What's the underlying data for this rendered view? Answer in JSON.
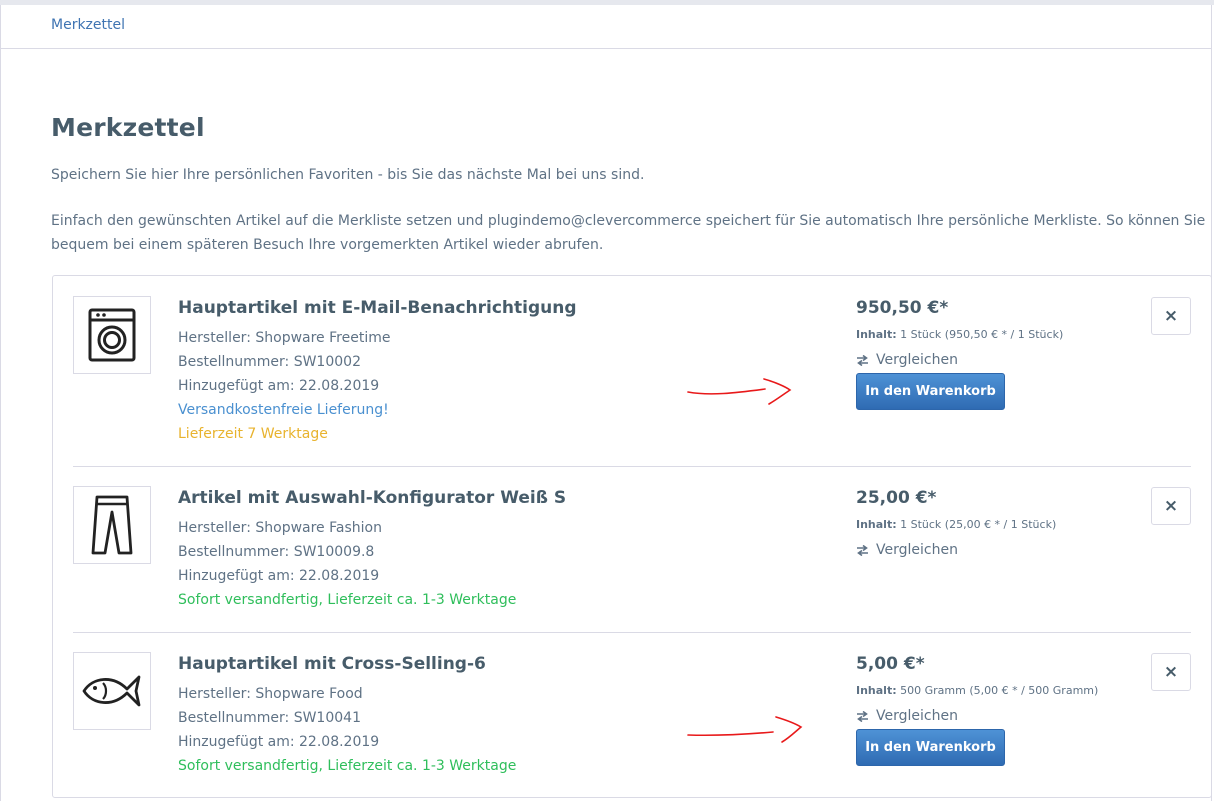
{
  "breadcrumb": {
    "label": "Merkzettel"
  },
  "page": {
    "title": "Merkzettel",
    "intro1": "Speichern Sie hier Ihre persönlichen Favoriten - bis Sie das nächste Mal bei uns sind.",
    "intro2": "Einfach den gewünschten Artikel auf die Merkliste setzen und plugindemo@clevercommerce speichert für Sie automatisch Ihre persönliche Merkliste. So können Sie bequem bei einem späteren Besuch Ihre vorgemerkten Artikel wieder abrufen."
  },
  "items": [
    {
      "name": "Hauptartikel mit E-Mail-Benachrichtigung",
      "manufacturer": "Hersteller: Shopware Freetime",
      "order_number": "Bestellnummer: SW10002",
      "added": "Hinzugefügt am: 22.08.2019",
      "shipping": "Versandkostenfreie Lieferung!",
      "delivery": "Lieferzeit 7 Werktage",
      "price": "950,50 €*",
      "content_label": "Inhalt:",
      "content_value": "1 Stück (950,50 € * / 1 Stück)",
      "compare": "Vergleichen",
      "cart": "In den Warenkorb",
      "remove": "×",
      "image_icon": "washing-machine-icon"
    },
    {
      "name": "Artikel mit Auswahl-Konfigurator Weiß S",
      "manufacturer": "Hersteller: Shopware Fashion",
      "order_number": "Bestellnummer: SW10009.8",
      "added": "Hinzugefügt am: 22.08.2019",
      "delivery": "Sofort versandfertig, Lieferzeit ca. 1-3 Werktage",
      "price": "25,00 €*",
      "content_label": "Inhalt:",
      "content_value": "1 Stück (25,00 € * / 1 Stück)",
      "compare": "Vergleichen",
      "remove": "×",
      "image_icon": "trousers-icon"
    },
    {
      "name": "Hauptartikel mit Cross-Selling-6",
      "manufacturer": "Hersteller: Shopware Food",
      "order_number": "Bestellnummer: SW10041",
      "added": "Hinzugefügt am: 22.08.2019",
      "delivery": "Sofort versandfertig, Lieferzeit ca. 1-3 Werktage",
      "price": "5,00 €*",
      "content_label": "Inhalt:",
      "content_value": "500 Gramm (5,00 € * / 500 Gramm)",
      "compare": "Vergleichen",
      "cart": "In den Warenkorb",
      "remove": "×",
      "image_icon": "fish-icon"
    }
  ],
  "colors": {
    "link": "#3f74b2",
    "heading": "#475c6a",
    "text": "#5f7285",
    "shipping_free": "#4a90d0",
    "delivery_warning": "#e8b32e",
    "delivery_ok": "#2fbe5b",
    "button_primary": "#3b7dc4",
    "annotation": "#e8191a"
  }
}
